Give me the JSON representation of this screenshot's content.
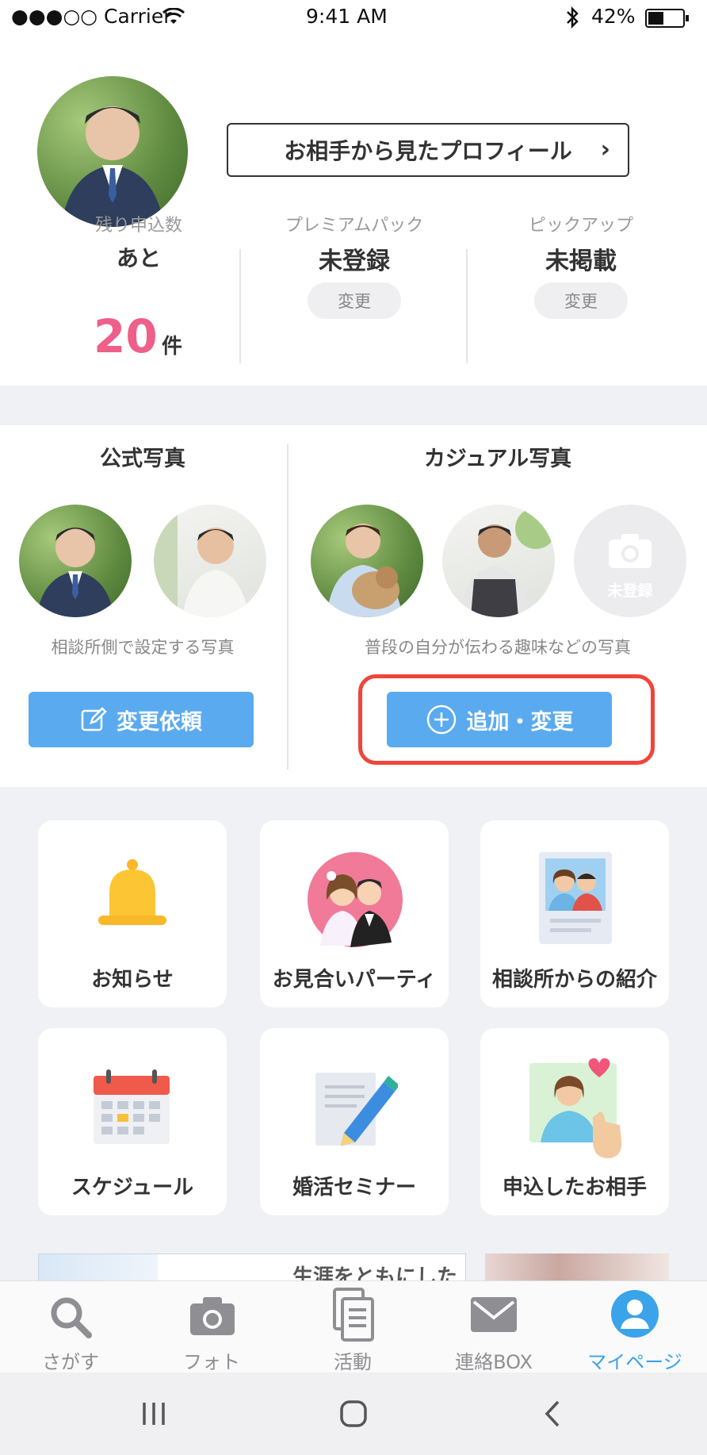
{
  "status_bar": {
    "carrier": "●●●○○ Carrier",
    "time": "9:41 AM",
    "battery": "42%"
  },
  "profile": {
    "view_button": "お相手から見たプロフィール",
    "remaining": {
      "label": "残り申込数",
      "prefix": "あと",
      "count": "20",
      "unit": "件"
    },
    "premium": {
      "label": "プレミアムパック",
      "value": "未登録",
      "button": "変更"
    },
    "pickup": {
      "label": "ピックアップ",
      "value": "未掲載",
      "button": "変更"
    }
  },
  "official_photos": {
    "title": "公式写真",
    "caption": "相談所側で設定する写真",
    "button": "変更依頼"
  },
  "casual_photos": {
    "title": "カジュアル写真",
    "caption": "普段の自分が伝わる趣味などの写真",
    "button": "追加・変更",
    "empty_slot": "未登録"
  },
  "tiles": [
    {
      "label": "お知らせ",
      "icon": "bell-icon"
    },
    {
      "label": "お見合いパーティ",
      "icon": "couple-icon"
    },
    {
      "label": "相談所からの紹介",
      "icon": "introduction-icon"
    },
    {
      "label": "スケジュール",
      "icon": "calendar-icon"
    },
    {
      "label": "婚活セミナー",
      "icon": "seminar-icon"
    },
    {
      "label": "申込したお相手",
      "icon": "applied-partner-icon"
    }
  ],
  "banner_text": "生涯をともにしたい",
  "tab_bar": [
    {
      "label": "さがす",
      "icon": "search-icon"
    },
    {
      "label": "フォト",
      "icon": "camera-icon"
    },
    {
      "label": "活動",
      "icon": "documents-icon"
    },
    {
      "label": "連絡BOX",
      "icon": "mail-icon"
    },
    {
      "label": "マイページ",
      "icon": "user-icon",
      "active": true
    }
  ],
  "colors": {
    "accent_blue": "#5aaaf0",
    "highlight_red": "#f0453a",
    "count_pink": "#ee5f8a",
    "tab_active": "#3ba3ea"
  }
}
